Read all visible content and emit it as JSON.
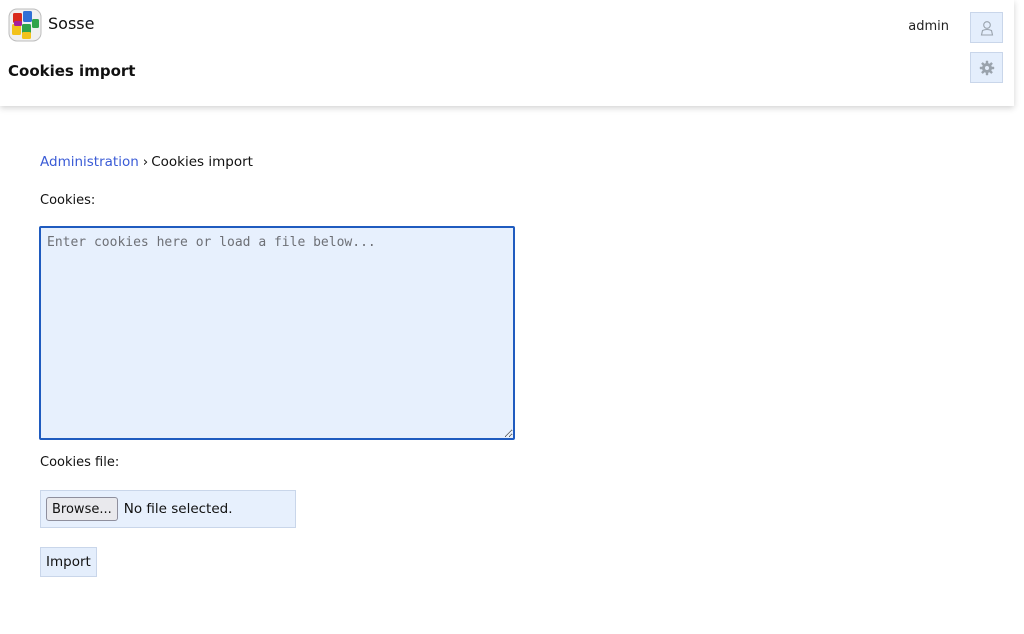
{
  "app": {
    "brand": "Sosse",
    "logo_icon": "sosse-logo-icon",
    "accent_color": "#1f5bbf",
    "link_color": "#3a5bd6",
    "field_background": "#e7f0fd"
  },
  "header": {
    "page_title": "Cookies import",
    "user_name": "admin",
    "user_icon": "user-icon",
    "settings_icon": "gear-icon"
  },
  "breadcrumb": {
    "parent": "Administration",
    "separator": "›",
    "current": "Cookies import"
  },
  "form": {
    "cookies_label": "Cookies:",
    "cookies_placeholder": "Enter cookies here or load a file below...",
    "cookies_value": "",
    "file_label": "Cookies file:",
    "browse_label": "Browse...",
    "file_status": "No file selected.",
    "import_label": "Import"
  }
}
